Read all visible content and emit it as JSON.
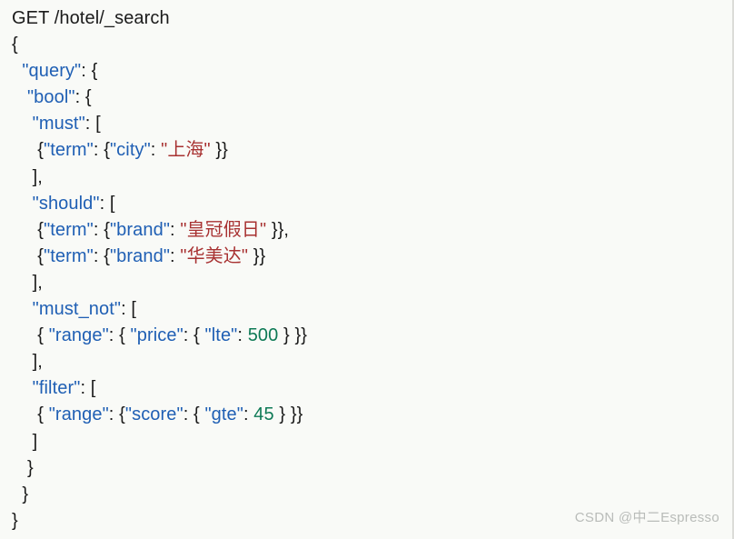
{
  "panel": {
    "background_color": "#f9faf7",
    "border_color": "#dcdcd8"
  },
  "syntax_colors": {
    "key": "#1f5fb4",
    "string": "#a83232",
    "number": "#0e7a56",
    "punctuation": "#1b1b1b",
    "plain": "#1b1b1b"
  },
  "request_line": "GET /hotel/_search",
  "code": {
    "lines": [
      {
        "indent": "",
        "tokens": [
          {
            "type": "plain",
            "text": "GET /hotel/_search"
          }
        ]
      },
      {
        "indent": "",
        "tokens": [
          {
            "type": "punct",
            "text": "{"
          }
        ]
      },
      {
        "indent": "  ",
        "tokens": [
          {
            "type": "key",
            "text": "\"query\""
          },
          {
            "type": "punct",
            "text": ": {"
          }
        ]
      },
      {
        "indent": "   ",
        "tokens": [
          {
            "type": "key",
            "text": "\"bool\""
          },
          {
            "type": "punct",
            "text": ": {"
          }
        ]
      },
      {
        "indent": "    ",
        "tokens": [
          {
            "type": "key",
            "text": "\"must\""
          },
          {
            "type": "punct",
            "text": ": ["
          }
        ]
      },
      {
        "indent": "     ",
        "tokens": [
          {
            "type": "punct",
            "text": "{"
          },
          {
            "type": "key",
            "text": "\"term\""
          },
          {
            "type": "punct",
            "text": ": {"
          },
          {
            "type": "key",
            "text": "\"city\""
          },
          {
            "type": "punct",
            "text": ": "
          },
          {
            "type": "str",
            "text": "\"上海\""
          },
          {
            "type": "punct",
            "text": " }}"
          }
        ]
      },
      {
        "indent": "    ",
        "tokens": [
          {
            "type": "punct",
            "text": "],"
          }
        ]
      },
      {
        "indent": "    ",
        "tokens": [
          {
            "type": "key",
            "text": "\"should\""
          },
          {
            "type": "punct",
            "text": ": ["
          }
        ]
      },
      {
        "indent": "     ",
        "tokens": [
          {
            "type": "punct",
            "text": "{"
          },
          {
            "type": "key",
            "text": "\"term\""
          },
          {
            "type": "punct",
            "text": ": {"
          },
          {
            "type": "key",
            "text": "\"brand\""
          },
          {
            "type": "punct",
            "text": ": "
          },
          {
            "type": "str",
            "text": "\"皇冠假日\""
          },
          {
            "type": "punct",
            "text": " }},"
          }
        ]
      },
      {
        "indent": "     ",
        "tokens": [
          {
            "type": "punct",
            "text": "{"
          },
          {
            "type": "key",
            "text": "\"term\""
          },
          {
            "type": "punct",
            "text": ": {"
          },
          {
            "type": "key",
            "text": "\"brand\""
          },
          {
            "type": "punct",
            "text": ": "
          },
          {
            "type": "str",
            "text": "\"华美达\""
          },
          {
            "type": "punct",
            "text": " }}"
          }
        ]
      },
      {
        "indent": "    ",
        "tokens": [
          {
            "type": "punct",
            "text": "],"
          }
        ]
      },
      {
        "indent": "    ",
        "tokens": [
          {
            "type": "key",
            "text": "\"must_not\""
          },
          {
            "type": "punct",
            "text": ": ["
          }
        ]
      },
      {
        "indent": "     ",
        "tokens": [
          {
            "type": "punct",
            "text": "{ "
          },
          {
            "type": "key",
            "text": "\"range\""
          },
          {
            "type": "punct",
            "text": ": { "
          },
          {
            "type": "key",
            "text": "\"price\""
          },
          {
            "type": "punct",
            "text": ": { "
          },
          {
            "type": "key",
            "text": "\"lte\""
          },
          {
            "type": "punct",
            "text": ": "
          },
          {
            "type": "num",
            "text": "500"
          },
          {
            "type": "punct",
            "text": " } }}"
          }
        ]
      },
      {
        "indent": "    ",
        "tokens": [
          {
            "type": "punct",
            "text": "],"
          }
        ]
      },
      {
        "indent": "    ",
        "tokens": [
          {
            "type": "key",
            "text": "\"filter\""
          },
          {
            "type": "punct",
            "text": ": ["
          }
        ]
      },
      {
        "indent": "     ",
        "tokens": [
          {
            "type": "punct",
            "text": "{ "
          },
          {
            "type": "key",
            "text": "\"range\""
          },
          {
            "type": "punct",
            "text": ": {"
          },
          {
            "type": "key",
            "text": "\"score\""
          },
          {
            "type": "punct",
            "text": ": { "
          },
          {
            "type": "key",
            "text": "\"gte\""
          },
          {
            "type": "punct",
            "text": ": "
          },
          {
            "type": "num",
            "text": "45"
          },
          {
            "type": "punct",
            "text": " } }}"
          }
        ]
      },
      {
        "indent": "    ",
        "tokens": [
          {
            "type": "punct",
            "text": "]"
          }
        ]
      },
      {
        "indent": "   ",
        "tokens": [
          {
            "type": "punct",
            "text": "}"
          }
        ]
      },
      {
        "indent": "  ",
        "tokens": [
          {
            "type": "punct",
            "text": "}"
          }
        ]
      },
      {
        "indent": "",
        "tokens": [
          {
            "type": "punct",
            "text": "}"
          }
        ]
      }
    ]
  },
  "watermark": {
    "text": "CSDN @中二Espresso"
  }
}
